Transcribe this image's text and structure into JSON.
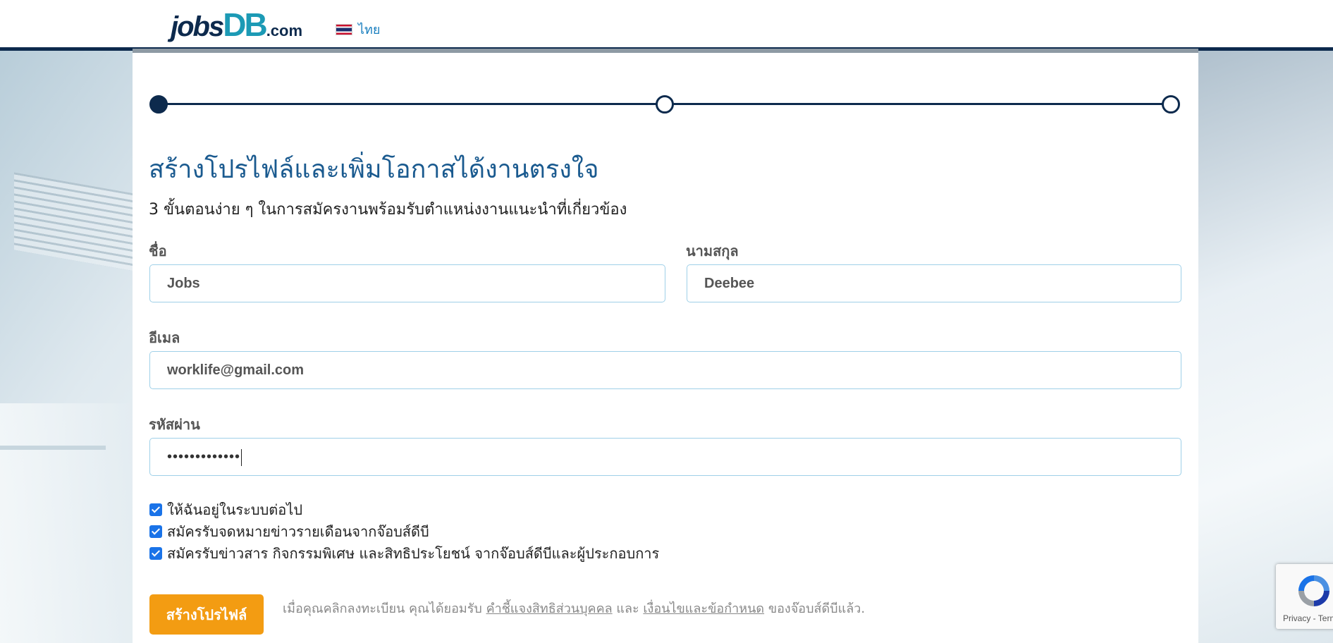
{
  "header": {
    "logo": {
      "jobs": "jobs",
      "db": "DB",
      "com": ".com"
    },
    "language_label": "ไทย",
    "flag_icon": "thailand-flag-icon"
  },
  "stepper": {
    "steps_total": 3,
    "current_step": 1
  },
  "form": {
    "title": "สร้างโปรไฟล์และเพิ่มโอกาสได้งานตรงใจ",
    "subtitle": "3 ขั้นตอนง่าย ๆ ในการสมัครงานพร้อมรับตำแหน่งงานแนะนำที่เกี่ยวข้อง",
    "first_name": {
      "label": "ชื่อ",
      "value": "Jobs"
    },
    "last_name": {
      "label": "นามสกุล",
      "value": "Deebee"
    },
    "email": {
      "label": "อีเมล",
      "value": "worklife@gmail.com"
    },
    "password": {
      "label": "รหัสผ่าน",
      "masked_value": "•••••••••••••"
    },
    "checkboxes": [
      {
        "label": "ให้ฉันอยู่ในระบบต่อไป",
        "checked": true
      },
      {
        "label": "สมัครรับจดหมายข่าวรายเดือนจากจ๊อบส์ดีบี",
        "checked": true
      },
      {
        "label": "สมัครรับข่าวสาร กิจกรรมพิเศษ และสิทธิประโยชน์ จากจ๊อบส์ดีบีและผู้ประกอบการ",
        "checked": true
      }
    ],
    "submit_label": "สร้างโปรไฟล์",
    "terms": {
      "prefix": "เมื่อคุณคลิกลงทะเบียน คุณได้ยอมรับ ",
      "privacy_link": "คำชี้แจงสิทธิส่วนบุคคล",
      "middle": " และ ",
      "terms_link": "เงื่อนไขและข้อกำหนด",
      "suffix": " ของจ๊อบส์ดีบีแล้ว."
    }
  },
  "recaptcha": {
    "links": "Privacy - Terms"
  },
  "colors": {
    "navy": "#0d2a4d",
    "title_blue": "#1a5a8f",
    "brand_teal": "#1c9ab5",
    "button_orange": "#f39c12",
    "input_border": "#9fd0e8",
    "checkbox_blue": "#1a73e8"
  }
}
